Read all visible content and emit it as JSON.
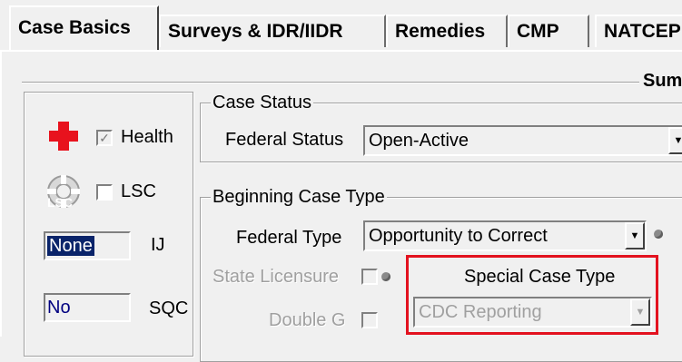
{
  "tabs": [
    {
      "label": "Case Basics",
      "active": true
    },
    {
      "label": "Surveys & IDR/IIDR",
      "active": false
    },
    {
      "label": "Remedies",
      "active": false
    },
    {
      "label": "CMP",
      "active": false
    },
    {
      "label": "NATCEP",
      "active": false
    }
  ],
  "summary_label": "Summa",
  "left_panel": {
    "health": {
      "label": "Health",
      "checked": true,
      "icon": "red-cross-icon"
    },
    "lsc": {
      "label": "LSC",
      "checked": false,
      "icon": "lsc-wheel-icon",
      "icon_text": "LSC"
    },
    "ij": {
      "value": "None",
      "label": "IJ"
    },
    "sqc": {
      "value": "No",
      "label": "SQC"
    }
  },
  "case_status": {
    "legend": "Case Status",
    "federal_status_label": "Federal Status",
    "federal_status_value": "Open-Active"
  },
  "beginning_case_type": {
    "legend": "Beginning Case Type",
    "federal_type_label": "Federal Type",
    "federal_type_value": "Opportunity to Correct",
    "state_licensure_label": "State Licensure",
    "double_g_label": "Double G"
  },
  "special_case_type": {
    "label": "Special Case Type",
    "value": "CDC Reporting",
    "highlight_color": "#e3121f"
  },
  "glyphs": {
    "dropdown_arrow": "▼",
    "check": "✓"
  }
}
